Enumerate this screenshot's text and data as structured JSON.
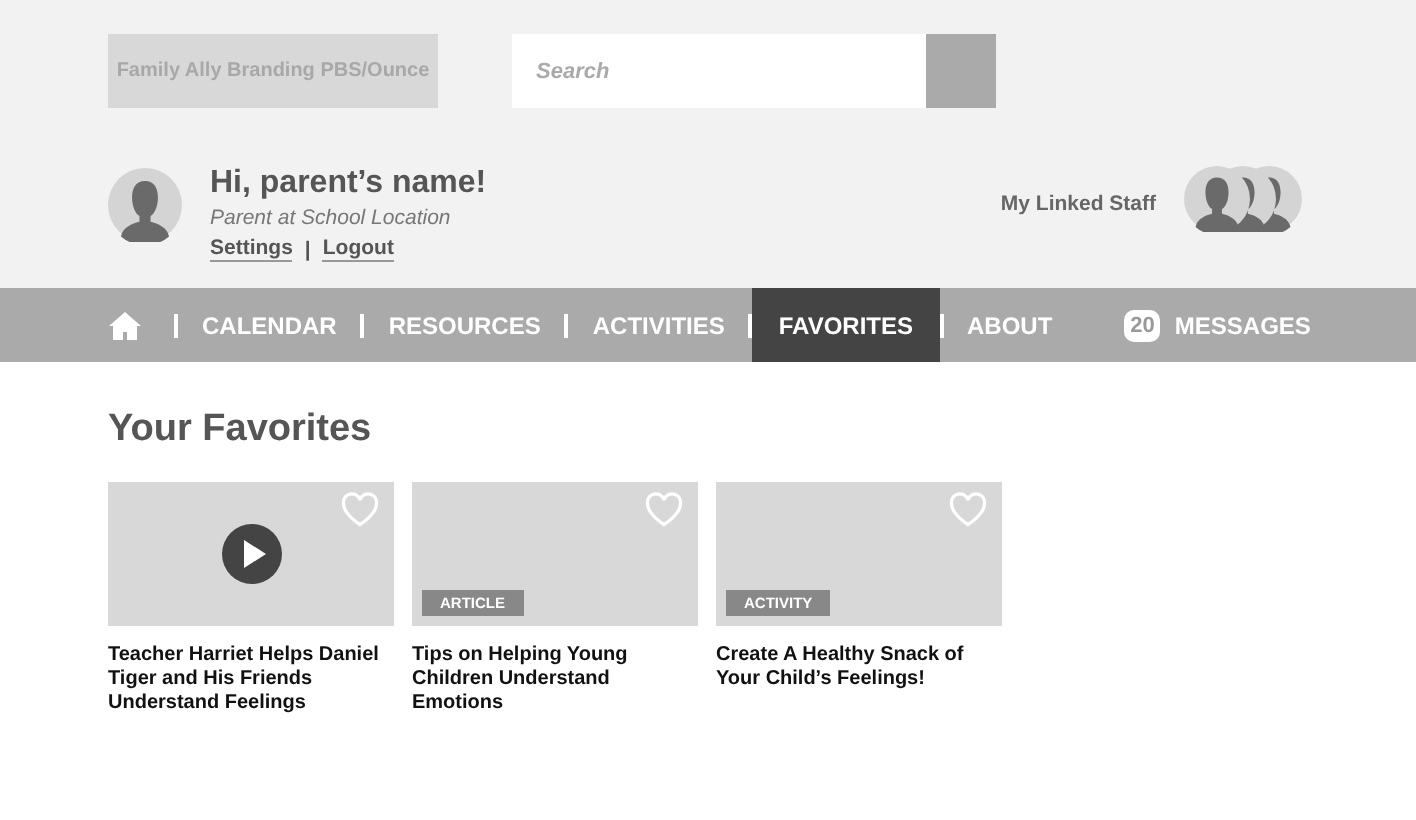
{
  "brand": {
    "text": "Family Ally Branding PBS/Ounce"
  },
  "search": {
    "placeholder": "Search"
  },
  "user": {
    "greeting": "Hi, parent’s name!",
    "role": "Parent at School Location",
    "links": [
      "Settings",
      "Logout"
    ],
    "link_separator": "|"
  },
  "linked_staff": {
    "label": "My Linked Staff",
    "avatars": [
      {
        "kind": "staff"
      },
      {
        "kind": "staff"
      },
      {
        "kind": "staff"
      }
    ]
  },
  "nav": [
    {
      "kind": "home",
      "selected": false
    },
    {
      "kind": "link",
      "label": "CALENDAR",
      "selected": false
    },
    {
      "kind": "link",
      "label": "RESOURCES",
      "selected": false
    },
    {
      "kind": "link",
      "label": "ACTIVITIES",
      "selected": false
    },
    {
      "kind": "link",
      "label": "FAVORITES",
      "selected": true
    },
    {
      "kind": "link",
      "label": "ABOUT",
      "selected": false
    },
    {
      "kind": "messages",
      "label": "MESSAGES",
      "count": "20",
      "selected": false
    }
  ],
  "favorites": {
    "title": "Your Favorites",
    "cards": [
      {
        "kind": "video",
        "title": "Teacher Harriet Helps Daniel Tiger and His Friends Understand Feelings"
      },
      {
        "kind": "tagged",
        "tag": "ARTICLE",
        "title": "Tips on Helping Young Children Understand Emotions"
      },
      {
        "kind": "tagged",
        "tag": "ACTIVITY",
        "title": "Create A Healthy Snack of Your Child’s Feelings!"
      }
    ]
  }
}
